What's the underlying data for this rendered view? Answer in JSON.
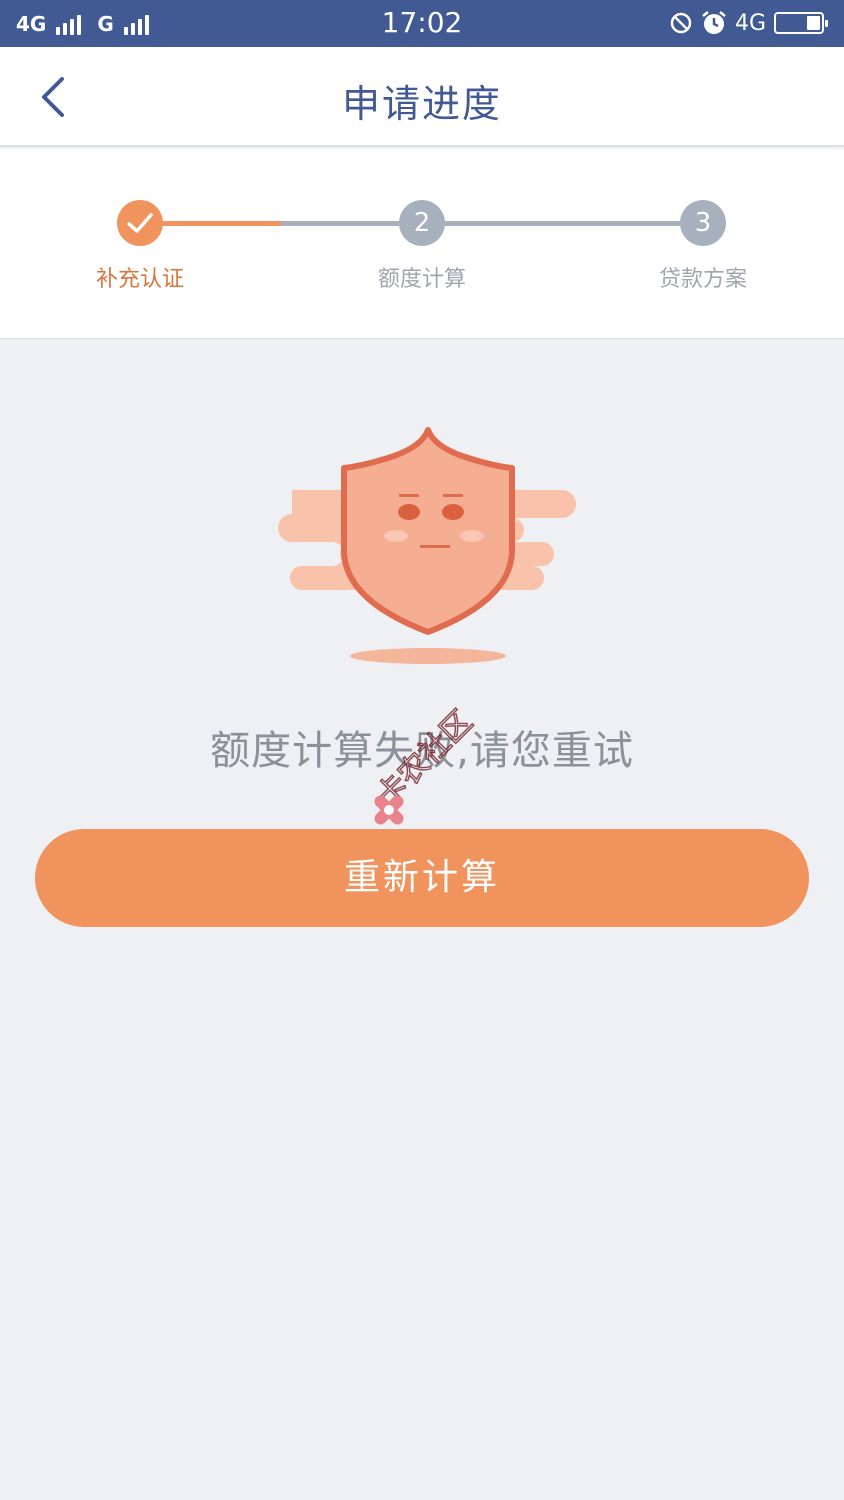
{
  "status_bar": {
    "network_1": "4G",
    "network_2": "G",
    "time": "17:02",
    "network_3": "4G"
  },
  "header": {
    "title": "申请进度",
    "back_icon": "chevron-left-icon"
  },
  "steps": [
    {
      "number": "",
      "label": "补充认证",
      "state": "completed",
      "icon": "check-icon"
    },
    {
      "number": "2",
      "label": "额度计算",
      "state": "pending"
    },
    {
      "number": "3",
      "label": "贷款方案",
      "state": "pending"
    }
  ],
  "content": {
    "illustration": "shield-mascot-illustration",
    "message": "额度计算失败,请您重试",
    "retry_button": "重新计算"
  },
  "watermark": {
    "text": "卡农社区",
    "icon": "knot-logo-icon"
  },
  "colors": {
    "status_bar": "#415a94",
    "accent": "#f0935d",
    "step_active_label": "#d9763f",
    "step_inactive": "#a7b0bd",
    "page_bg": "#eef0f3"
  }
}
